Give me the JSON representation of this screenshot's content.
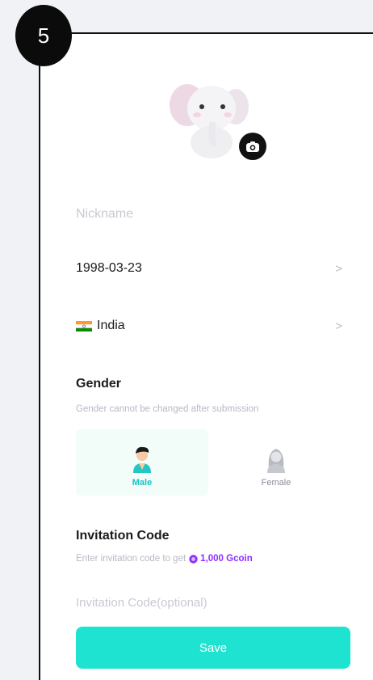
{
  "step_badge": "5",
  "profile": {
    "nickname_placeholder": "Nickname",
    "birthday": "1998-03-23",
    "country_flag": "india-flag-icon",
    "country": "India"
  },
  "gender": {
    "title": "Gender",
    "hint": "Gender cannot be changed after submission",
    "options": [
      {
        "label": "Male",
        "selected": true
      },
      {
        "label": "Female",
        "selected": false
      }
    ]
  },
  "invitation": {
    "title": "Invitation Code",
    "hint_prefix": "Enter invitation code to get",
    "reward": "1,000 Gcoin",
    "placeholder": "Invitation Code(optional)"
  },
  "save_label": "Save",
  "colors": {
    "accent": "#1ee3d1",
    "male_accent": "#19c2c4",
    "gcoin": "#8e2fff"
  }
}
